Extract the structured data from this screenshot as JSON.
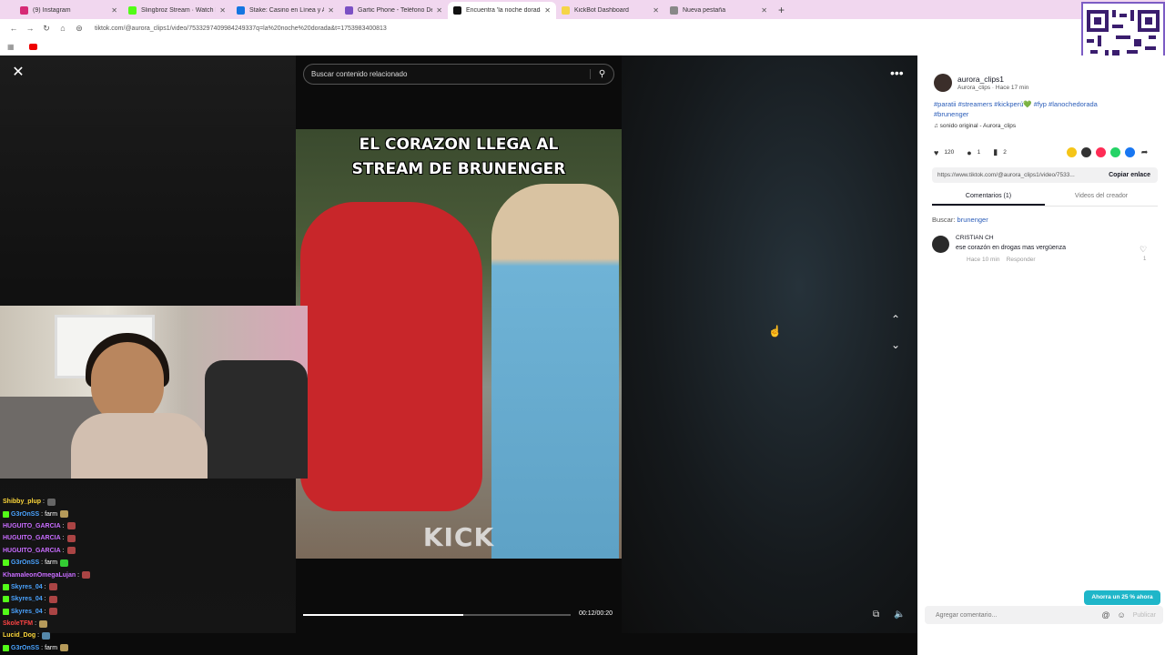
{
  "browser": {
    "tabs": [
      {
        "label": "(9) Instagram",
        "color": "#d62976"
      },
      {
        "label": "Slingbroz Stream · Watch Live o",
        "color": "#53fc18"
      },
      {
        "label": "Stake: Casino en Línea y Apuest",
        "color": "#1475e1"
      },
      {
        "label": "Gartic Phone - Teléfono Desco",
        "color": "#7b50c4"
      },
      {
        "label": "Encuentra 'la noche dorada'",
        "color": "#111111"
      },
      {
        "label": "KickBot Dashboard",
        "color": "#f5d547"
      },
      {
        "label": "Nueva pestaña",
        "color": "#888888"
      }
    ],
    "new_tab": "+",
    "url": "tiktok.com/@aurora_clips1/video/7533297409984249337q=la%20noche%20dorada&t=1753983400813"
  },
  "player": {
    "close": "✕",
    "search_placeholder": "Buscar contenido relacionado",
    "search_icon": "⚲",
    "overlay_title_line1": "EL CORAZON LLEGA AL",
    "overlay_title_line2": "STREAM DE BRUNENGER",
    "watermark": "KICK",
    "more": "•••",
    "prev": "⌃",
    "next": "⌄",
    "timecode": "00:12/00:20",
    "progress": 0.6,
    "pip_icon": "⧉",
    "volume_icon": "🔈"
  },
  "chat": [
    {
      "user": "Shibby_plup",
      "color": "#ffd93b",
      "text": "",
      "badge": "",
      "emote": "#666"
    },
    {
      "user": "G3rOnSS",
      "color": "#4aa3ff",
      "text": "farm",
      "badge": "#53fc18",
      "emote": "#b59a5a"
    },
    {
      "user": "HUGUITO_GARCIA",
      "color": "#c86cff",
      "text": "",
      "badge": "",
      "emote": "#a44"
    },
    {
      "user": "HUGUITO_GARCIA",
      "color": "#c86cff",
      "text": "",
      "badge": "",
      "emote": "#a44"
    },
    {
      "user": "HUGUITO_GARCIA",
      "color": "#c86cff",
      "text": "",
      "badge": "",
      "emote": "#a44"
    },
    {
      "user": "G3rOnSS",
      "color": "#4aa3ff",
      "text": "farm",
      "badge": "#53fc18",
      "emote": "#3c3"
    },
    {
      "user": "KhamaleonOmegaLujan",
      "color": "#c86cff",
      "text": "",
      "badge": "",
      "emote": "#a44"
    },
    {
      "user": "Skyres_04",
      "color": "#4aa3ff",
      "text": "",
      "badge": "#53fc18",
      "emote": "#a44"
    },
    {
      "user": "Skyres_04",
      "color": "#4aa3ff",
      "text": "",
      "badge": "#53fc18",
      "emote": "#a44"
    },
    {
      "user": "Skyres_04",
      "color": "#4aa3ff",
      "text": "",
      "badge": "#53fc18",
      "emote": "#a44"
    },
    {
      "user": "SkoleTFM",
      "color": "#ff4444",
      "text": "",
      "badge": "",
      "emote": "#b59a5a"
    },
    {
      "user": "Lucid_Dog",
      "color": "#ffd93b",
      "text": "",
      "badge": "",
      "emote": "#58a"
    },
    {
      "user": "G3rOnSS",
      "color": "#4aa3ff",
      "text": "farm",
      "badge": "#53fc18",
      "emote": "#b59a5a"
    }
  ],
  "panel": {
    "username": "aurora_clips1",
    "meta": "Aurora_clips · Hace 17 min",
    "description": "#paratii #streamers #kickperú💚 #fyp #lanochedorada #brunenger",
    "sound": "♫  sonido original - Aurora_clips",
    "likes": "120",
    "comments": "1",
    "saves": "2",
    "link": "https://www.tiktok.com/@aurora_clips1/video/7533...",
    "copy_link": "Copiar enlace",
    "tab_comments": "Comentarios (1)",
    "tab_creator": "Videos del creador",
    "search_label": "Buscar:",
    "search_kw": "brunenger",
    "comment_user": "CRISTIAN CH",
    "comment_text": "ese corazón en drogas mas vergüenza",
    "comment_time": "Hace 10 min",
    "comment_reply": "Responder",
    "comment_likes": "1",
    "promo": "Ahorra un 25 % ahora",
    "add_comment": "Agregar comentario...",
    "publish": "Publicar"
  }
}
